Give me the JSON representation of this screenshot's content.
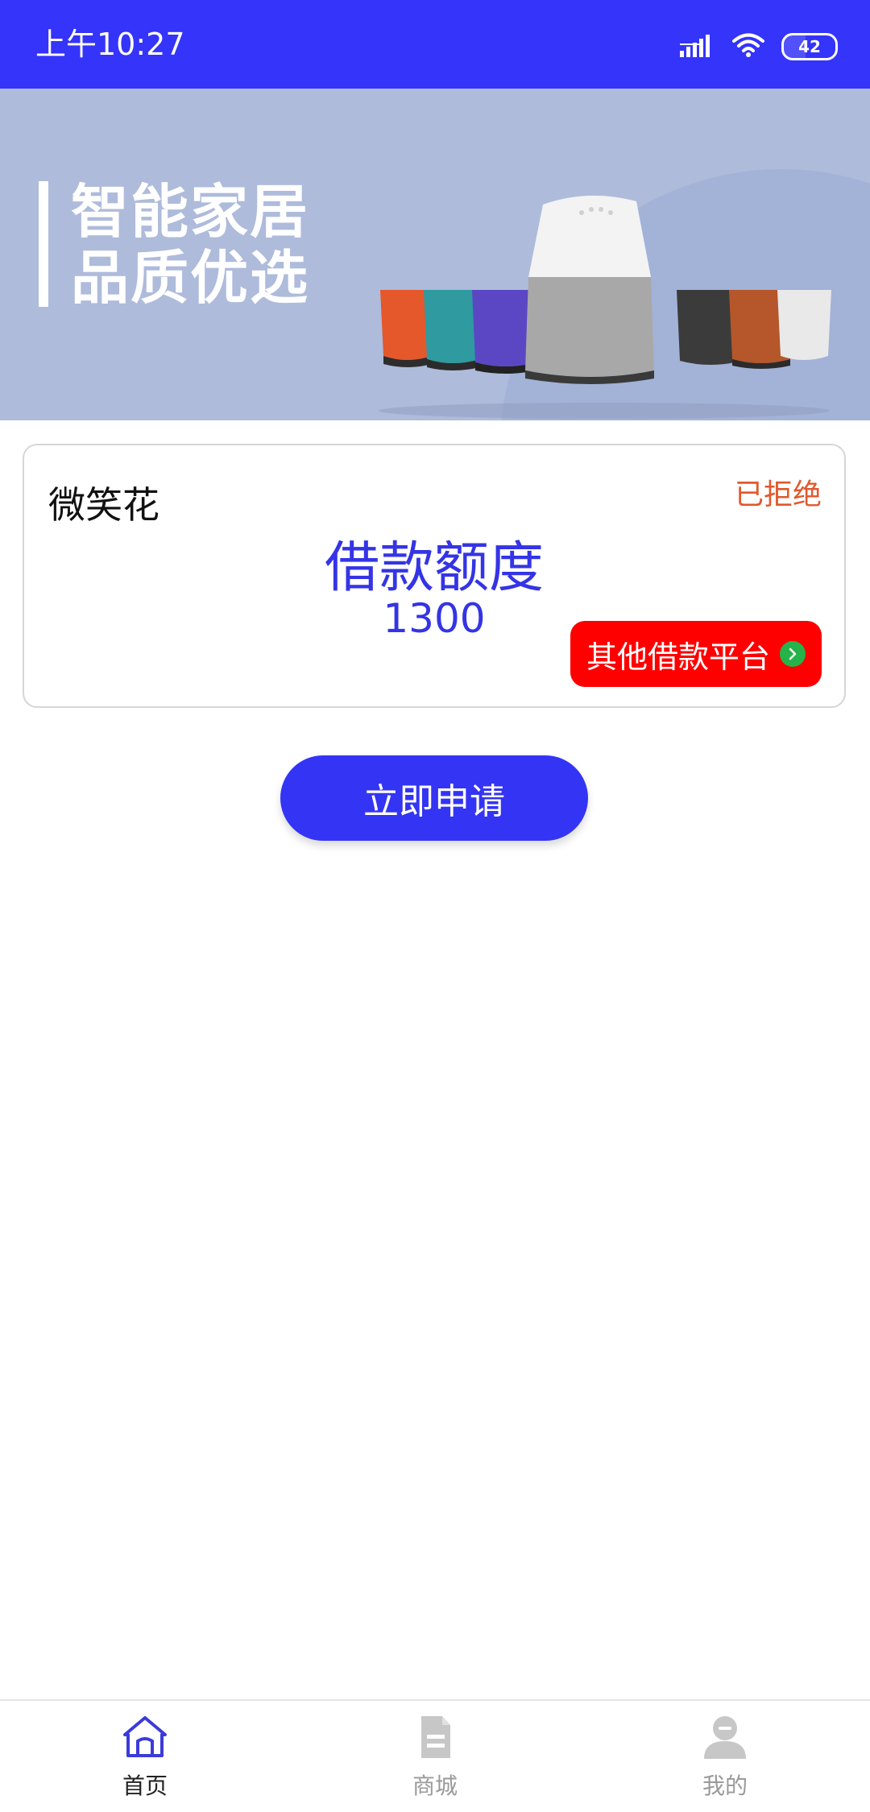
{
  "status_bar": {
    "time": "上午10:27",
    "battery": "42"
  },
  "banner": {
    "line1": "智能家居",
    "line2": "品质优选"
  },
  "card": {
    "name": "微笑花",
    "status": "已拒绝",
    "label": "借款额度",
    "value": "1300",
    "other_button": "其他借款平台"
  },
  "apply_button": "立即申请",
  "nav": {
    "items": [
      {
        "label": "首页",
        "icon": "home-icon",
        "active": true
      },
      {
        "label": "商城",
        "icon": "document-icon",
        "active": false
      },
      {
        "label": "我的",
        "icon": "user-icon",
        "active": false
      }
    ]
  },
  "colors": {
    "brand": "#3434fb",
    "status_rejected": "#e0582c",
    "other_button": "#ff0000",
    "nav_active": "#3b3bdb",
    "nav_inactive": "#c7c7c7"
  }
}
